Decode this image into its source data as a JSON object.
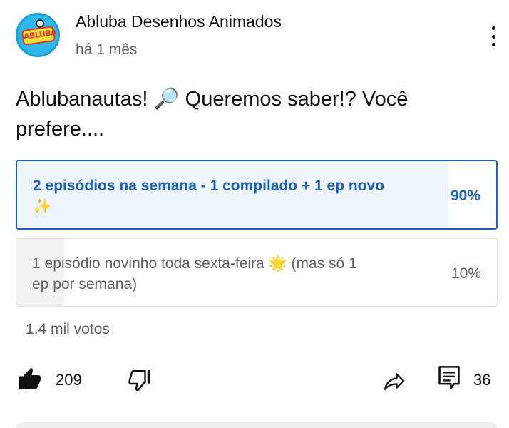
{
  "header": {
    "channel_name": "Abluba Desenhos Animados",
    "date": "há 1 mês",
    "avatar_text": "ABLUBA"
  },
  "post": {
    "text_line1": "Ablubanautas! 🔎 Queremos saber!? Você",
    "text_line2": "prefere...."
  },
  "poll": {
    "options": [
      {
        "label_line1": "2 episódios na semana - 1 compilado + 1 ep novo",
        "label_line2": "✨",
        "percent": "90%",
        "fill_fraction": 0.9,
        "selected": true
      },
      {
        "label_line1": "1 episódio novinho toda sexta-feira 🌟 (mas só 1",
        "label_line2": "ep por semana)",
        "percent": "10%",
        "fill_fraction": 0.1,
        "selected": false
      }
    ],
    "votes": "1,4 mil votos"
  },
  "actions": {
    "likes": "209",
    "comments": "36"
  },
  "colors": {
    "accent_blue": "#1c62b9",
    "selected_fill": "#eef5fd",
    "unselected_fill": "#f2f2f2",
    "secondary_text": "#606060"
  },
  "icons": {
    "menu": "more-vert-icon",
    "like": "thumbs-up-icon",
    "dislike": "thumbs-down-icon",
    "share": "share-icon",
    "comment": "comment-icon"
  }
}
